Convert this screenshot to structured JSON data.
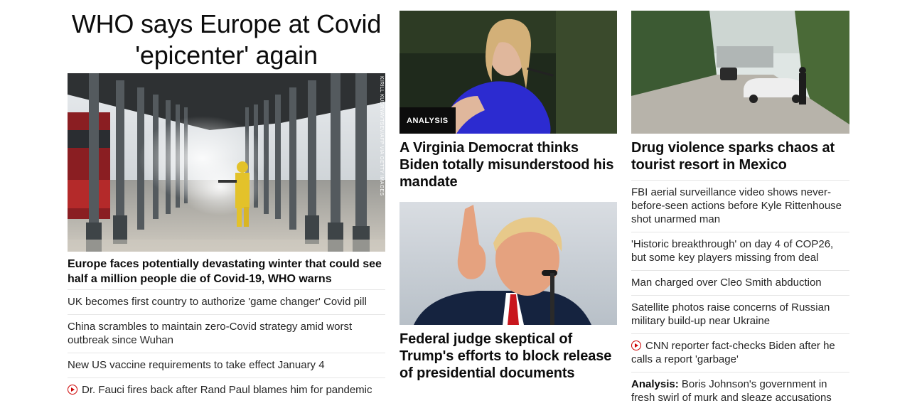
{
  "left": {
    "lead_title": "WHO says Europe at Covid 'epicenter' again",
    "image_credit": "KIRILL KUDRYAVTSEV/AFP VIA GETTY IMAGES",
    "image_alt": "Worker disinfecting a railway platform",
    "main_headline": "Europe faces potentially devastating winter that could see half a million people die of Covid-19, WHO warns",
    "items": [
      {
        "text": "UK becomes first country to authorize 'game changer' Covid pill",
        "video": false
      },
      {
        "text": "China scrambles to maintain zero-Covid strategy amid worst outbreak since Wuhan",
        "video": false
      },
      {
        "text": "New US vaccine requirements to take effect January 4",
        "video": false
      },
      {
        "text": "Dr. Fauci fires back after Rand Paul blames him for pandemic",
        "video": true
      }
    ]
  },
  "middle": {
    "story1": {
      "badge": "ANALYSIS",
      "headline": "A Virginia Democrat thinks Biden totally misunderstood his mandate"
    },
    "story2": {
      "headline": "Federal judge skeptical of Trump's efforts to block release of presidential documents"
    }
  },
  "right": {
    "main_headline": "Drug violence sparks chaos at tourist resort in Mexico",
    "items": [
      {
        "text": "FBI aerial surveillance video shows never-before-seen actions before Kyle Rittenhouse shot unarmed man",
        "video": false
      },
      {
        "text": "'Historic breakthrough' on day 4 of COP26, but some key players missing from deal",
        "video": false
      },
      {
        "text": "Man charged over Cleo Smith abduction",
        "video": false
      },
      {
        "text": "Satellite photos raise concerns of Russian military build-up near Ukraine",
        "video": false
      },
      {
        "text": "CNN reporter fact-checks Biden after he calls a report 'garbage'",
        "video": true
      },
      {
        "prefix": "Analysis:",
        "text": "Boris Johnson's government in fresh swirl of murk and sleaze accusations",
        "video": false
      }
    ]
  },
  "colors": {
    "text": "#0c0c0c",
    "video_icon": "#cc0000",
    "divider": "#e6e6e6",
    "badge_bg": "#0c0c0c"
  }
}
